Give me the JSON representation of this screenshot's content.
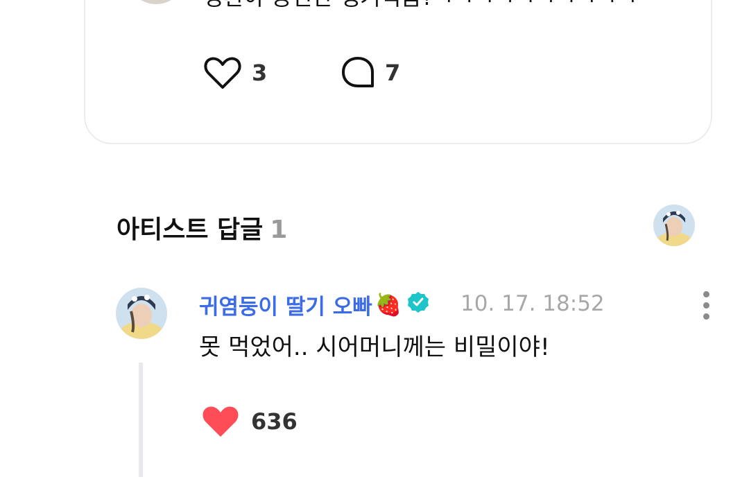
{
  "post": {
    "text": "정환아 공진단 챙겨먹음?ㅋㅋㅋㅋㅋㅋㅋㅋㅋㅋ",
    "like_count": "3",
    "comment_count": "7",
    "like_icon": "heart-outline-icon",
    "comment_icon": "comment-bubble-icon"
  },
  "artist_replies": {
    "title": "아티스트 답글",
    "count": "1"
  },
  "reply": {
    "author": "귀염둥이 딸기 오빠",
    "author_emoji": "🍓",
    "verified_icon": "verified-badge-icon",
    "timestamp": "10. 17. 18:52",
    "text": "못 먹었어.. 시어머니께는 비밀이야!",
    "like_count": "636",
    "like_icon": "heart-filled-icon",
    "menu_icon": "more-vertical-icon"
  },
  "colors": {
    "author_blue": "#3c6be6",
    "heart_red": "#ff4d57",
    "verified_teal": "#1ec5c8",
    "muted_gray": "#a7a7a7",
    "border_gray": "#ececec"
  }
}
